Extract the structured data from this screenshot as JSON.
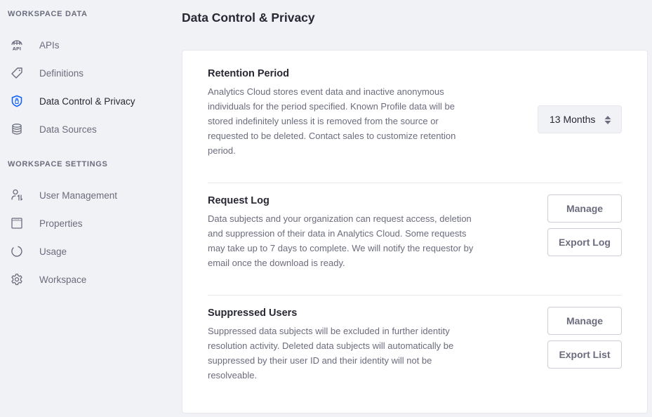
{
  "sidebar": {
    "sections": [
      {
        "title": "Workspace Data",
        "items": [
          {
            "label": "APIs",
            "icon": "api-globe-icon"
          },
          {
            "label": "Definitions",
            "icon": "tag-icon"
          },
          {
            "label": "Data Control & Privacy",
            "icon": "shield-lock-icon",
            "active": true
          },
          {
            "label": "Data Sources",
            "icon": "database-icon"
          }
        ]
      },
      {
        "title": "Workspace Settings",
        "items": [
          {
            "label": "User Management",
            "icon": "user-sort-icon"
          },
          {
            "label": "Properties",
            "icon": "window-icon"
          },
          {
            "label": "Usage",
            "icon": "circle-progress-icon"
          },
          {
            "label": "Workspace",
            "icon": "gear-icon"
          }
        ]
      }
    ]
  },
  "page": {
    "title": "Data Control & Privacy"
  },
  "retention": {
    "title": "Retention Period",
    "description": "Analytics Cloud stores event data and inactive anonymous individuals for the period specified. Known Profile data will be stored indefinitely unless it is removed from the source or requested to be deleted. Contact sales to customize retention period.",
    "selected": "13 Months"
  },
  "request_log": {
    "title": "Request Log",
    "description": "Data subjects and your organization can request access, deletion and suppression of their data in Analytics Cloud. Some requests may take up to 7 days to complete. We will notify the requestor by email once the download is ready.",
    "manage_label": "Manage",
    "export_label": "Export Log"
  },
  "suppressed_users": {
    "title": "Suppressed Users",
    "description": "Suppressed data subjects will be excluded in further identity resolution activity. Deleted data subjects will automatically be suppressed by their user ID and their identity will not be resolveable.",
    "manage_label": "Manage",
    "export_label": "Export List"
  },
  "colors": {
    "accent": "#0b5fff",
    "text_primary": "#272833",
    "text_secondary": "#6b6c7e",
    "background": "#f1f2f5"
  }
}
